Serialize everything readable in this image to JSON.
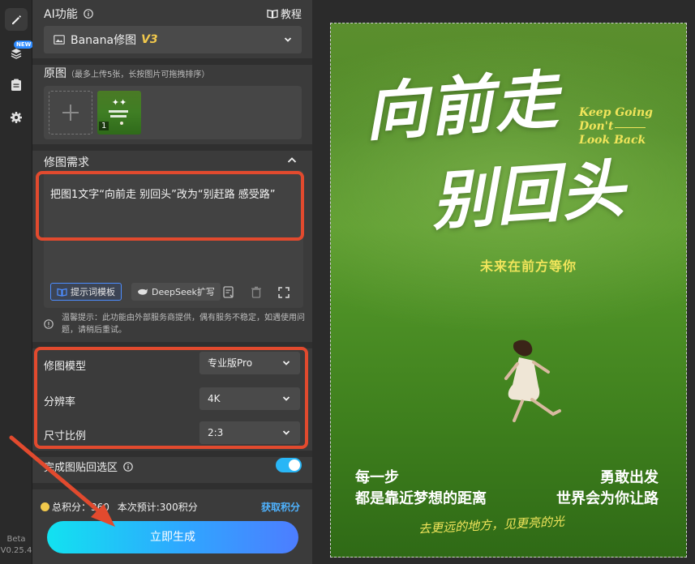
{
  "sidebar": {
    "new_badge": "NEW",
    "beta": "Beta",
    "version": "V0.25.4"
  },
  "panel": {
    "ai_title": "AI功能",
    "tutorial": "教程",
    "model_name": "Banana修图",
    "model_version": "V3",
    "original_title": "原图",
    "original_hint": "（最多上传5张，长按图片可拖拽排序）",
    "thumb_index": "1",
    "request_title": "修图需求",
    "prompt_text": "把图1文字“向前走 别回头”改为“别赶路 感受路”",
    "template_chip": "提示词模板",
    "deepseek_chip": "DeepSeek扩写",
    "tip": "温馨提示：此功能由外部服务商提供，偶有服务不稳定，如遇使用问题，请稍后重试。",
    "params": [
      {
        "label": "修图模型",
        "value": "专业版Pro"
      },
      {
        "label": "分辨率",
        "value": "4K"
      },
      {
        "label": "尺寸比例",
        "value": "2:3"
      }
    ],
    "paste_back": "完成图贴回选区",
    "paste_back_on": true,
    "points_label": "总积分：",
    "points_value": "360",
    "estimate": "本次预计:300积分",
    "get_points": "获取积分",
    "generate": "立即生成"
  },
  "preview": {
    "line1": "向前走",
    "line2": "别回头",
    "english": [
      "Keep Going",
      "Don't",
      "Look Back"
    ],
    "subtitle": "未来在前方等你",
    "left_text": [
      "每一步",
      "都是靠近梦想的距离"
    ],
    "right_text": [
      "勇敢出发",
      "世界会为你让路"
    ],
    "script_line": "去更远的地方，见更亮的光"
  },
  "colors": {
    "highlight": "#e24a2e",
    "accent_blue": "#2fa6ff",
    "accent_yellow": "#f1e55b"
  }
}
